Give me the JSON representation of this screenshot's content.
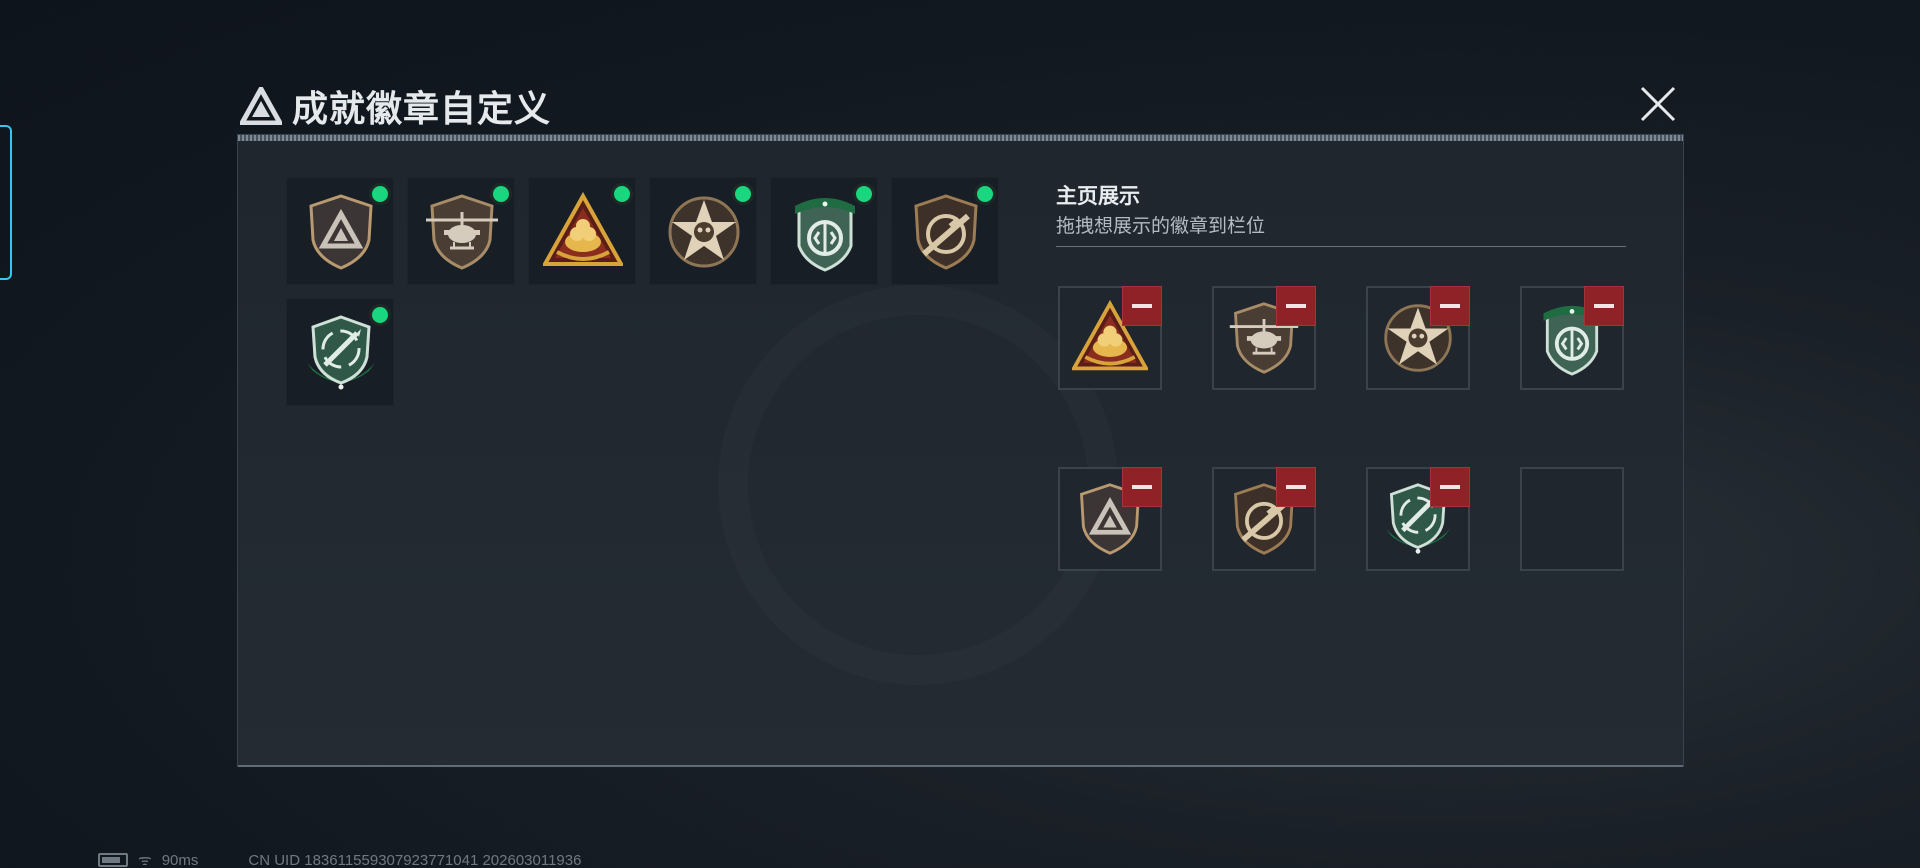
{
  "header": {
    "title": "成就徽章自定义",
    "title_icon": "delta-triangle-icon",
    "close_icon": "close-icon"
  },
  "owned_badges": [
    {
      "badge": "delta-shield-badge",
      "new": true
    },
    {
      "badge": "helicopter-shield-badge",
      "new": true
    },
    {
      "badge": "golden-nest-triangle-badge",
      "new": true
    },
    {
      "badge": "skull-star-badge",
      "new": true
    },
    {
      "badge": "green-crest-badge",
      "new": true
    },
    {
      "badge": "rifle-crosshair-badge",
      "new": true
    },
    {
      "badge": "green-missile-badge",
      "new": true
    }
  ],
  "showcase": {
    "title": "主页展示",
    "subtitle": "拖拽想展示的徽章到栏位",
    "slots": [
      {
        "badge": "golden-nest-triangle-badge"
      },
      {
        "badge": "helicopter-shield-badge"
      },
      {
        "badge": "skull-star-badge"
      },
      {
        "badge": "green-crest-badge"
      },
      {
        "badge": "delta-shield-badge"
      },
      {
        "badge": "rifle-crosshair-badge"
      },
      {
        "badge": "green-missile-badge"
      },
      {
        "badge": null
      }
    ],
    "remove_icon": "minus-icon"
  },
  "status_bar": {
    "ping": "90ms",
    "uid": "CN UID 18361155930792377104​1 202603011936"
  },
  "colors": {
    "new_dot": "#19d67f",
    "remove": "#8e2226",
    "accent_frame": "#37c7e8"
  }
}
